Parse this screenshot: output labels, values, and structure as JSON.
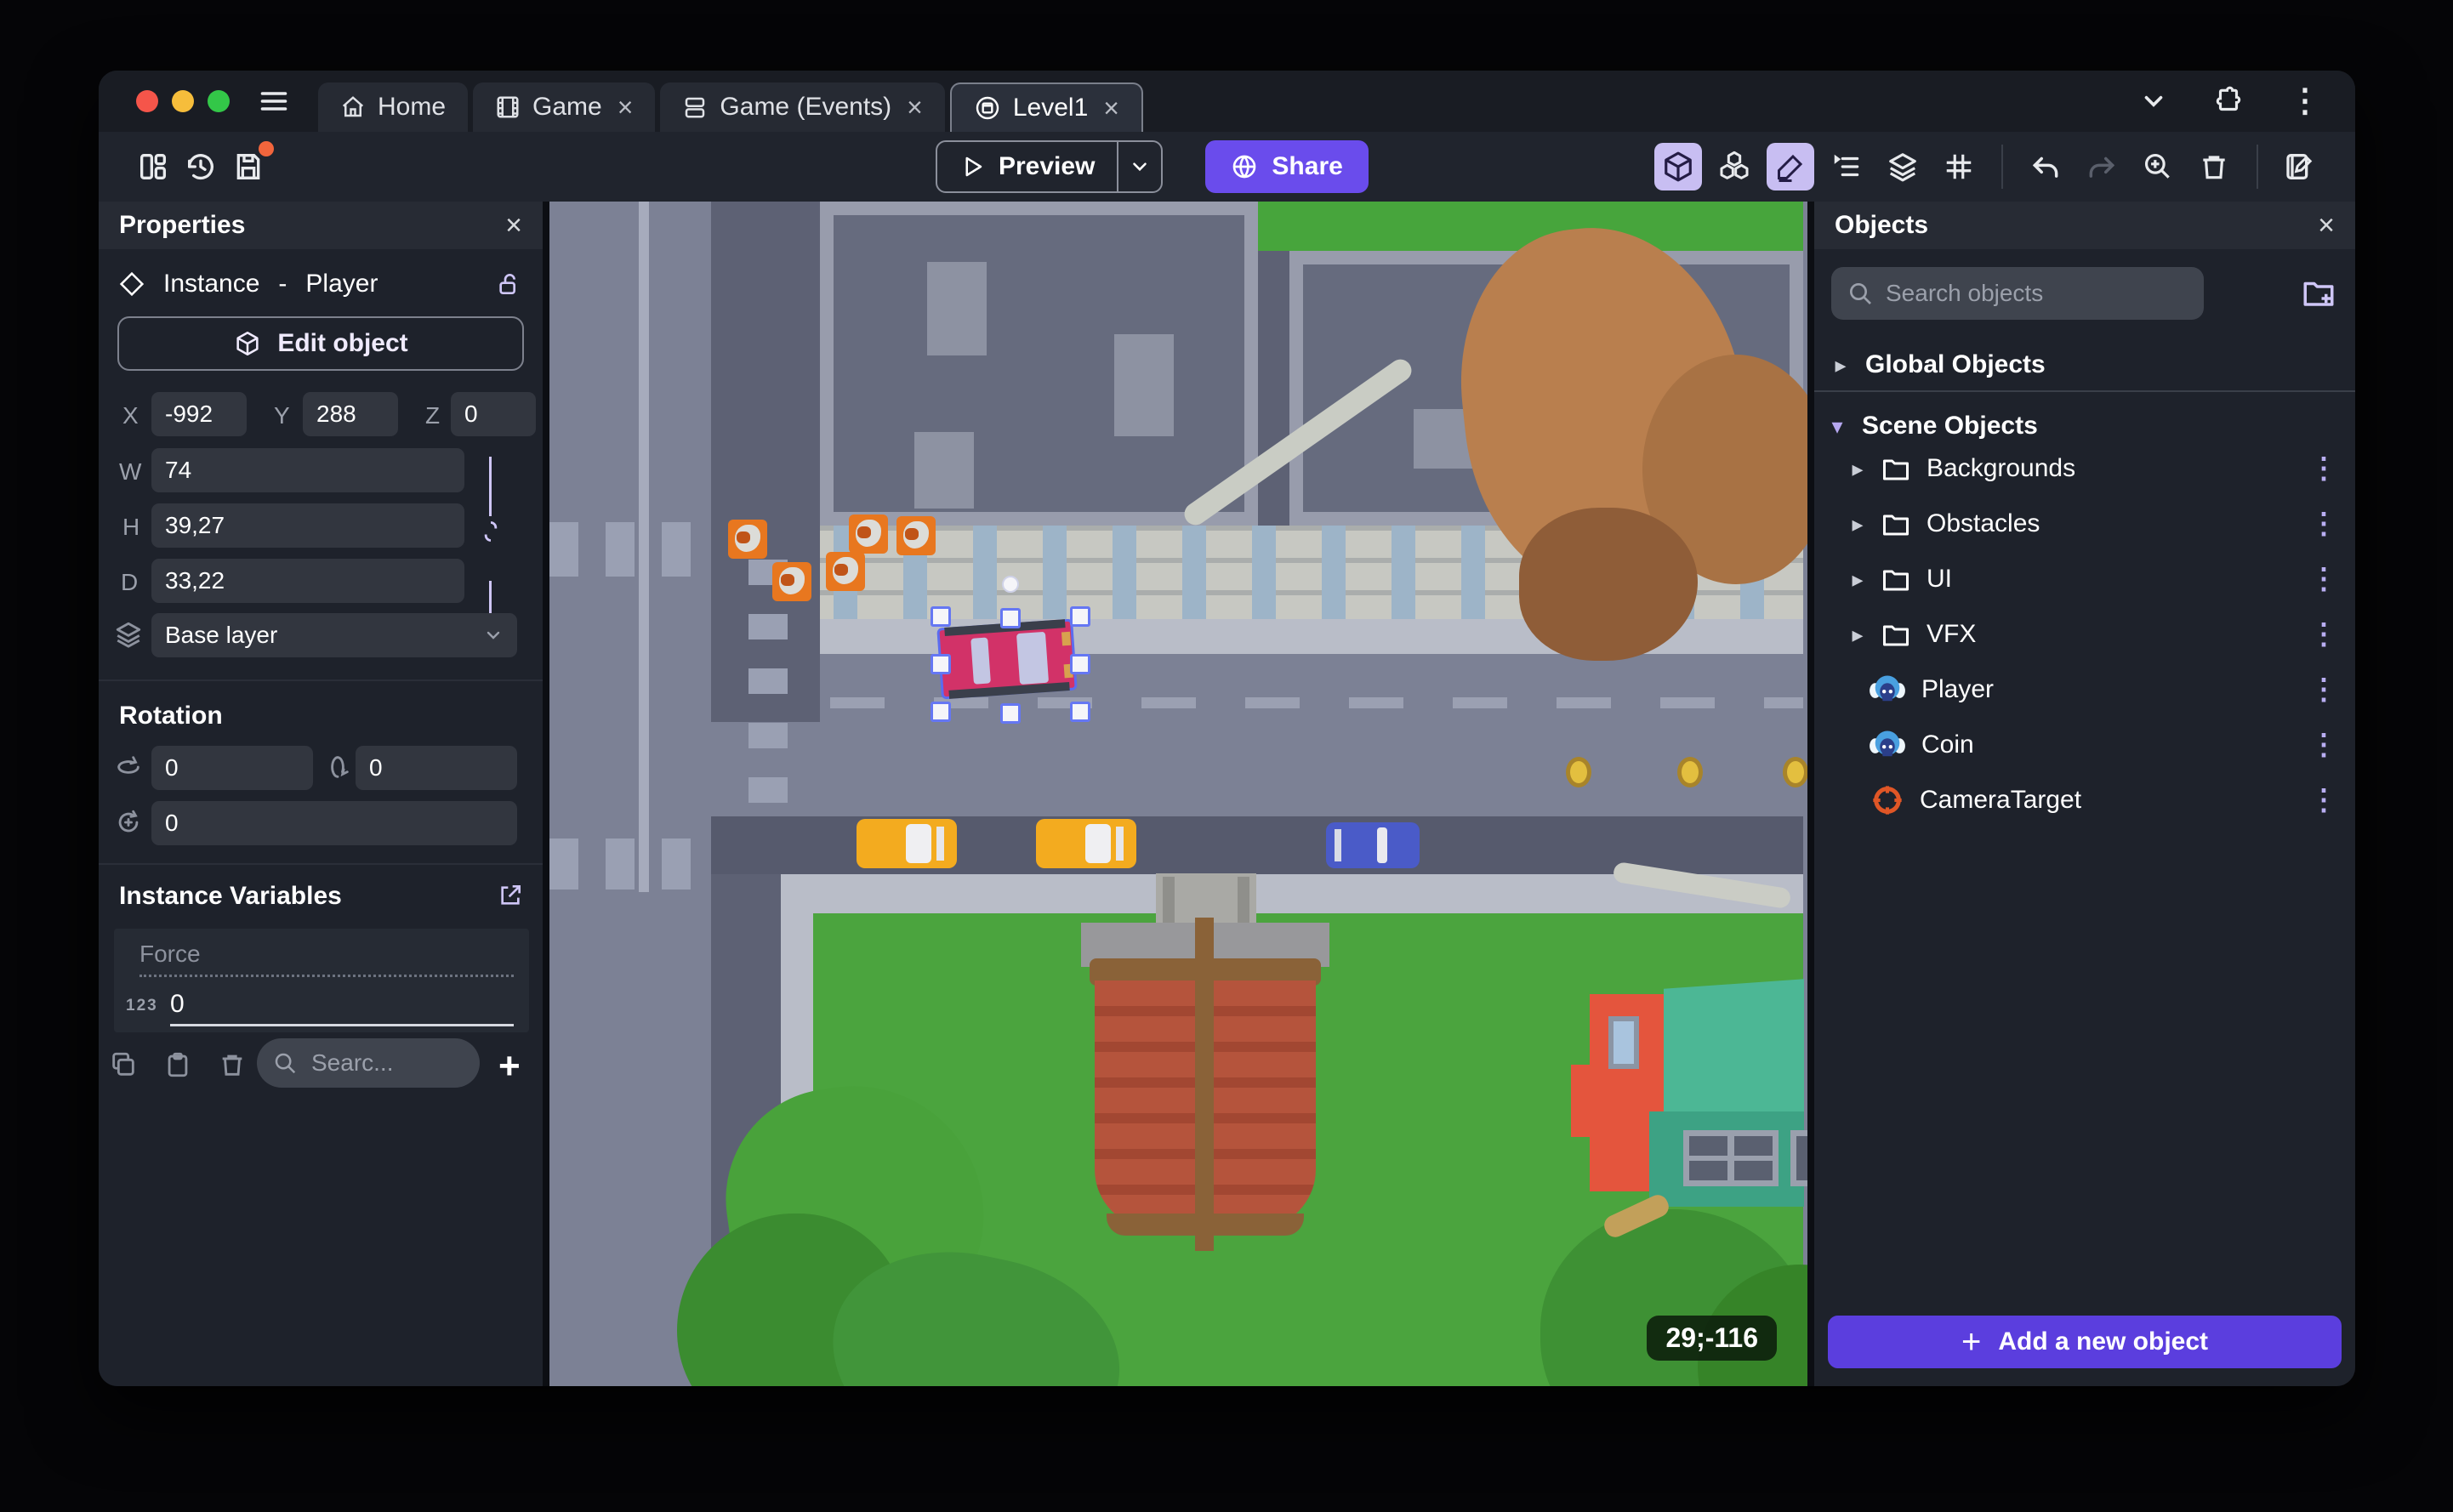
{
  "chrome": {
    "tabs": [
      {
        "label": "Home",
        "icon": "home-icon",
        "closable": false,
        "active": false
      },
      {
        "label": "Game",
        "icon": "film-icon",
        "closable": true,
        "active": false
      },
      {
        "label": "Game (Events)",
        "icon": "events-sheet-icon",
        "closable": true,
        "active": false
      },
      {
        "label": "Level1",
        "icon": "scene-icon",
        "closable": true,
        "active": true
      }
    ]
  },
  "toolbar": {
    "preview_label": "Preview",
    "share_label": "Share"
  },
  "properties": {
    "title": "Properties",
    "instance_type": "Instance",
    "separator": "-",
    "object_name": "Player",
    "edit_object_label": "Edit object",
    "coords": {
      "x_label": "X",
      "x": "-992",
      "y_label": "Y",
      "y": "288",
      "z_label": "Z",
      "z": "0"
    },
    "size": {
      "w_label": "W",
      "w": "74",
      "h_label": "H",
      "h": "39,27",
      "d_label": "D",
      "d": "33,22"
    },
    "layer": "Base layer",
    "rotation_title": "Rotation",
    "rotation_x": "0",
    "rotation_y": "0",
    "rotation_z": "0",
    "variables_title": "Instance Variables",
    "variable": {
      "name": "Force",
      "value": "0",
      "type_badge": "123"
    },
    "search_placeholder": "Searc..."
  },
  "objects": {
    "title": "Objects",
    "search_placeholder": "Search objects",
    "groups": {
      "global": "Global Objects",
      "scene": "Scene Objects"
    },
    "folders": [
      {
        "name": "Backgrounds"
      },
      {
        "name": "Obstacles"
      },
      {
        "name": "UI"
      },
      {
        "name": "VFX"
      }
    ],
    "items": [
      {
        "name": "Player"
      },
      {
        "name": "Coin"
      },
      {
        "name": "CameraTarget"
      }
    ],
    "add_button_label": "Add a new object"
  },
  "canvas": {
    "cursor_coordinates": "29;-116"
  },
  "glyphs": {
    "close": "×",
    "kebab": "⋮",
    "caret_right": "▸",
    "caret_down": "▾",
    "plus": "+"
  },
  "colors": {
    "accent_purple": "#6a4cec",
    "add_button": "#5b3ede",
    "selection": "#6577f3",
    "traffic_red": "#f5554a",
    "traffic_yellow": "#f6bd3b",
    "traffic_green": "#33c748"
  }
}
